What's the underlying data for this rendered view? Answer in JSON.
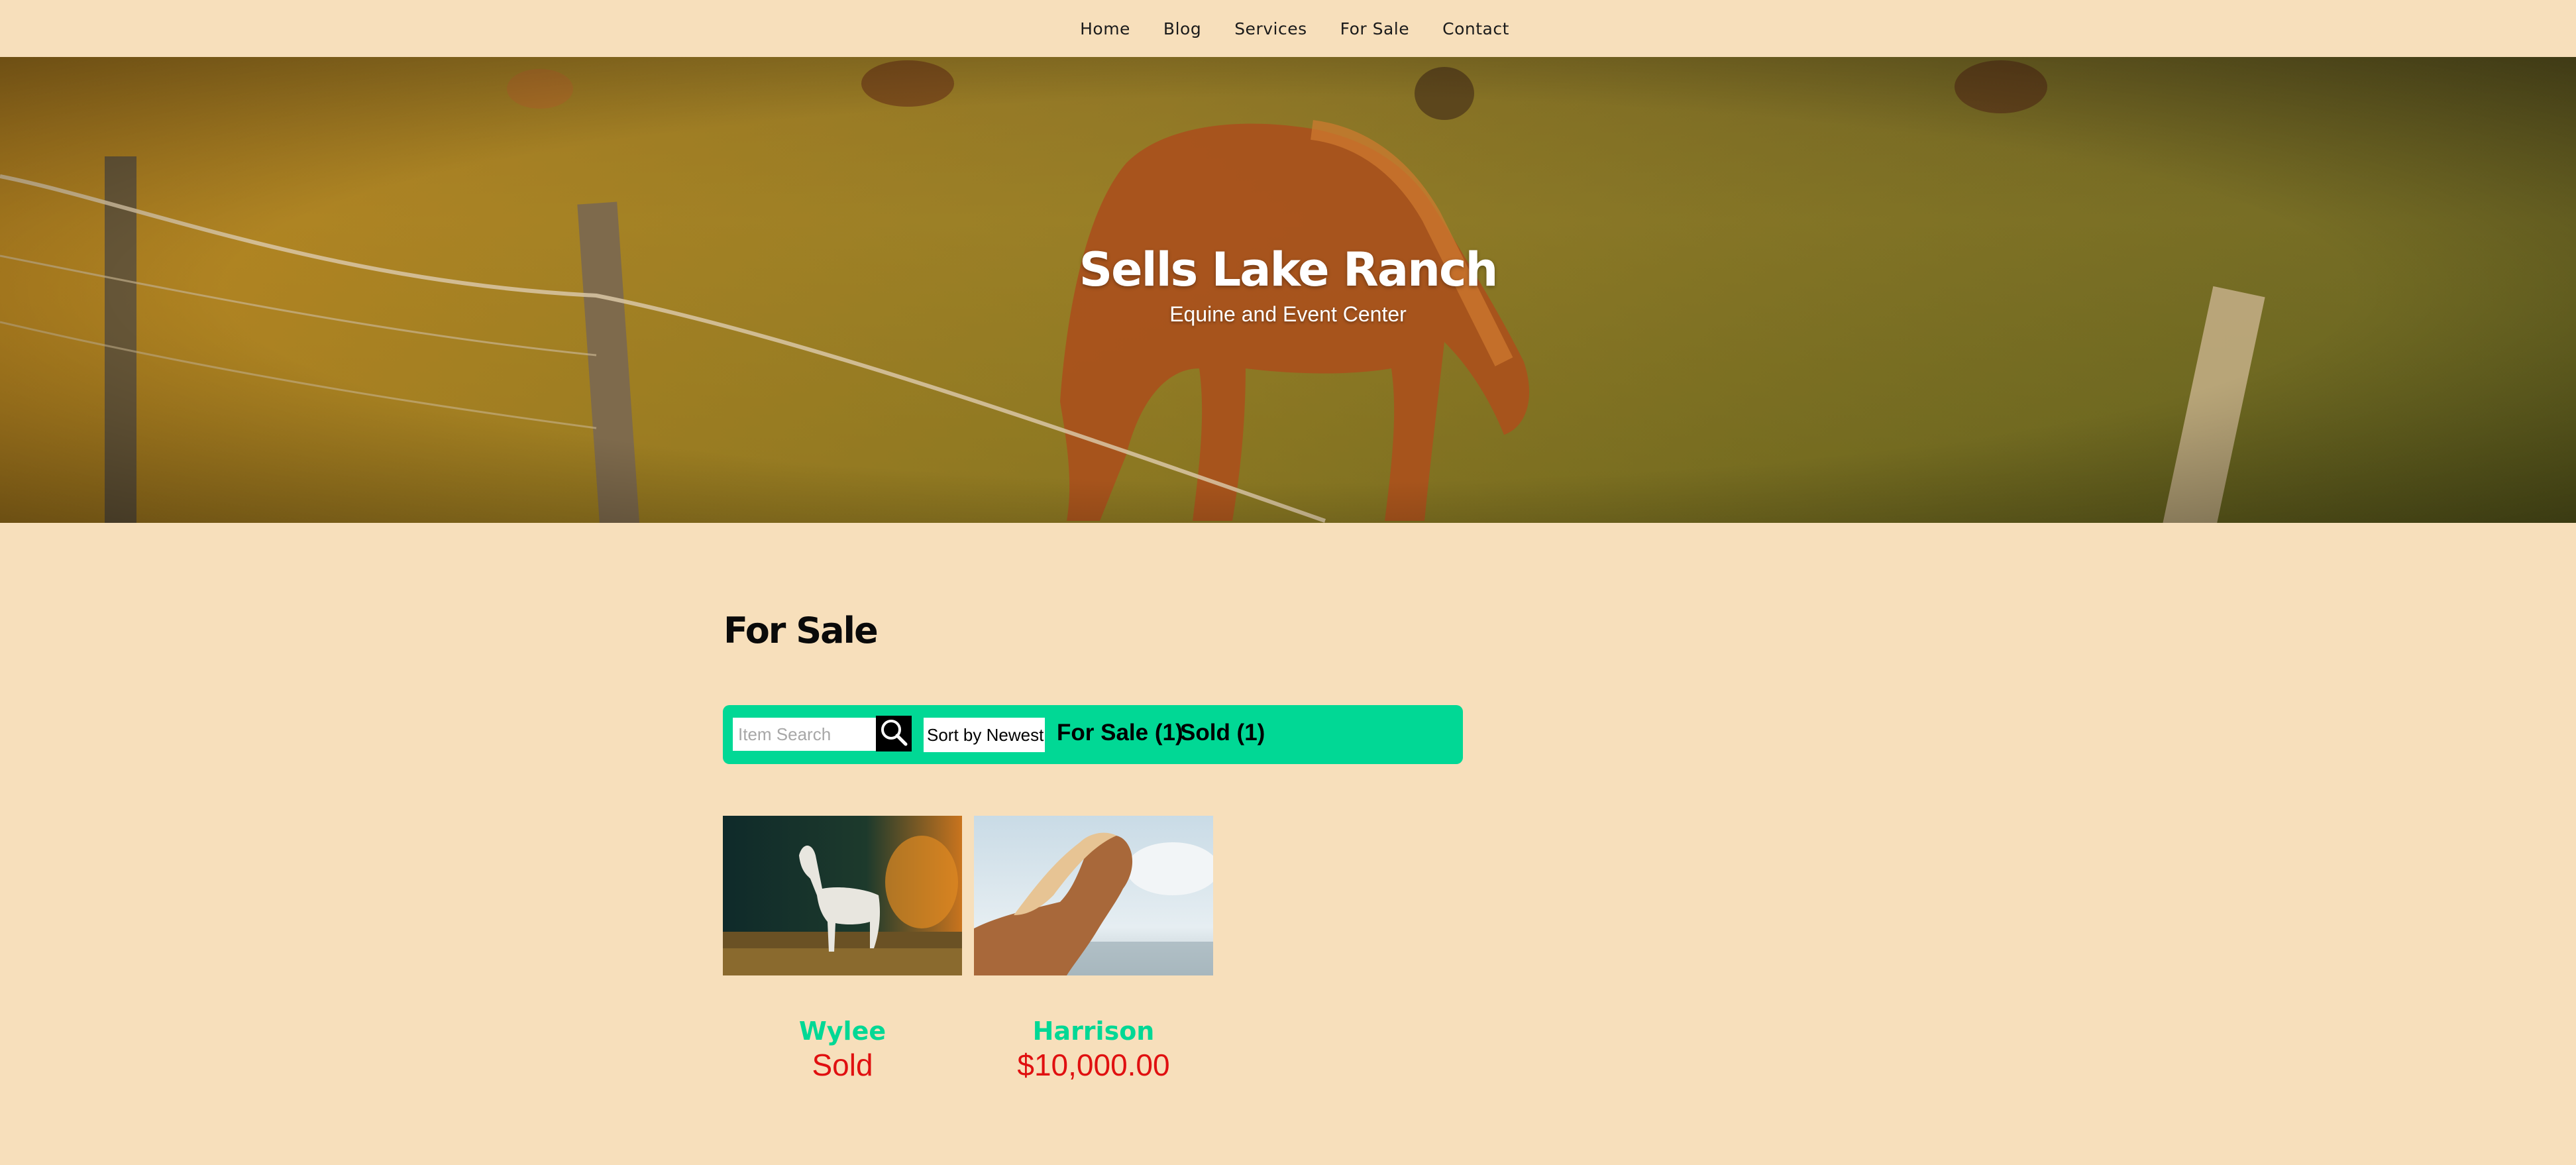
{
  "nav": {
    "items": [
      "Home",
      "Blog",
      "Services",
      "For Sale",
      "Contact"
    ]
  },
  "hero": {
    "title": "Sells Lake Ranch",
    "subtitle": "Equine and Event Center"
  },
  "main": {
    "title": "For Sale",
    "filters": {
      "search_placeholder": "Item Search",
      "sort_label": "Sort by Newest",
      "for_sale_label": "For Sale (1)",
      "sold_label": "Sold (1)"
    },
    "listings": [
      {
        "name": "Wylee",
        "price": "Sold"
      },
      {
        "name": "Harrison",
        "price": "$10,000.00"
      }
    ]
  },
  "colors": {
    "background": "#f7dfbb",
    "accent": "#01d895",
    "price": "#e01010"
  },
  "icons": [
    "search-icon"
  ]
}
